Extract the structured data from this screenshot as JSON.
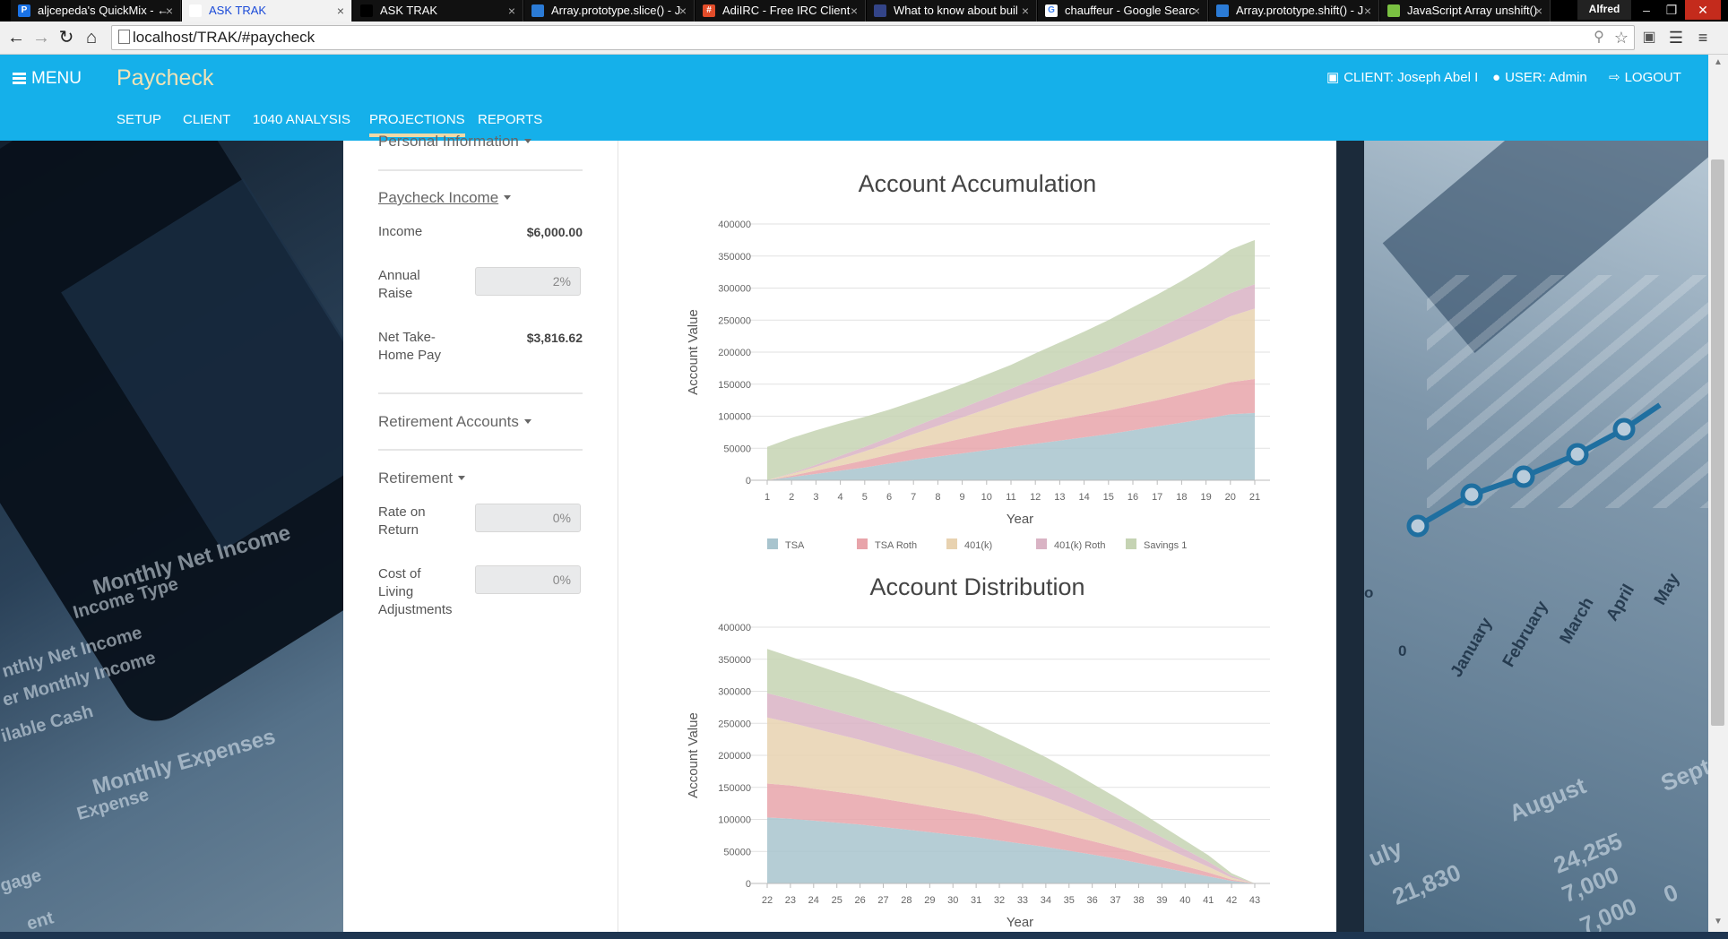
{
  "browser": {
    "tabs": [
      {
        "label": "aljcepeda's QuickMix - ←",
        "favicon": "P",
        "favcolor": "#1a73e8",
        "active": false
      },
      {
        "label": "ASK TRAK",
        "favicon": "",
        "favcolor": "#ffffff",
        "active": true
      },
      {
        "label": "ASK TRAK",
        "favicon": "",
        "favcolor": "#000000",
        "active": false
      },
      {
        "label": "Array.prototype.slice() - J",
        "favicon": "",
        "favcolor": "#2b7bd6",
        "active": false
      },
      {
        "label": "AdiIRC - Free IRC Client",
        "favicon": "#",
        "favcolor": "#e34d2a",
        "active": false
      },
      {
        "label": "What to know about buil",
        "favicon": "",
        "favcolor": "#334488",
        "active": false
      },
      {
        "label": "chauffeur - Google Searc",
        "favicon": "G",
        "favcolor": "#ffffff",
        "active": false
      },
      {
        "label": "Array.prototype.shift() - J",
        "favicon": "",
        "favcolor": "#2b7bd6",
        "active": false
      },
      {
        "label": "JavaScript Array unshift()",
        "favicon": "",
        "favcolor": "#7ac142",
        "active": false
      }
    ],
    "profile": "Alfred",
    "url": "localhost/TRAK/#paycheck"
  },
  "header": {
    "menu_label": "MENU",
    "brand": "Paycheck",
    "client_label": "CLIENT: Joseph Abel I",
    "user_label": "USER: Admin",
    "logout_label": "LOGOUT",
    "tabs": [
      "SETUP",
      "CLIENT",
      "1040 ANALYSIS",
      "PROJECTIONS",
      "REPORTS"
    ],
    "active_tab": "PROJECTIONS"
  },
  "sidebar": {
    "personal_info": "Personal Information",
    "paycheck_income": "Paycheck Income",
    "income_label": "Income",
    "income_value": "$6,000.00",
    "raise_label": "Annual Raise",
    "raise_value": "2%",
    "net_label": "Net Take-Home Pay",
    "net_value": "$3,816.62",
    "retirement_accounts": "Retirement Accounts",
    "retirement": "Retirement",
    "rate_label": "Rate on Return",
    "rate_value": "0%",
    "cola_label": "Cost of Living Adjustments",
    "cola_value": "0%"
  },
  "background": {
    "left_texts": [
      "Monthly Net Income",
      "Income Type",
      "nthly Net Income",
      "er Monthly Income",
      "ilable Cash",
      "Monthly Expenses",
      "Expense",
      "gage",
      "ent"
    ],
    "right_texts": [
      "January",
      "February",
      "March",
      "April",
      "May",
      "August",
      "Septe",
      "24,255",
      "7,000",
      "21,830",
      "7,000",
      "uly",
      "0",
      "0",
      "o"
    ]
  },
  "colors": {
    "header": "#15b0ea",
    "TSA": "#a8c4ce",
    "TSA Roth": "#e8a4aa",
    "401(k)": "#e8d2b0",
    "401(k) Roth": "#d9b3c4",
    "Savings 1": "#c5d3b3"
  },
  "chart_data": [
    {
      "type": "area",
      "stacked": true,
      "title": "Account Accumulation",
      "xlabel": "Year",
      "ylabel": "Account Value",
      "ylim": [
        0,
        400000
      ],
      "yticks": [
        0,
        50000,
        100000,
        150000,
        200000,
        250000,
        300000,
        350000,
        400000
      ],
      "x": [
        "1",
        "2",
        "3",
        "4",
        "5",
        "6",
        "7",
        "8",
        "9",
        "10",
        "11",
        "12",
        "13",
        "14",
        "15",
        "16",
        "17",
        "18",
        "19",
        "20",
        "21"
      ],
      "legend": "bottom",
      "grid": true,
      "series": [
        {
          "name": "TSA",
          "values": [
            0,
            5000,
            10000,
            15000,
            20000,
            26000,
            32000,
            37000,
            42000,
            47000,
            52000,
            57000,
            62000,
            67000,
            72000,
            78000,
            84000,
            90000,
            96000,
            103000,
            105000
          ]
        },
        {
          "name": "TSA Roth",
          "values": [
            0,
            2000,
            5000,
            8000,
            11000,
            14000,
            17000,
            20000,
            23000,
            26000,
            29000,
            31000,
            33000,
            35000,
            37000,
            39000,
            41000,
            44000,
            47000,
            50000,
            53000
          ]
        },
        {
          "name": "401(k)",
          "values": [
            0,
            3000,
            6000,
            10000,
            14000,
            18000,
            23000,
            28000,
            33000,
            38000,
            43000,
            49000,
            55000,
            61000,
            67000,
            74000,
            81000,
            88000,
            95000,
            103000,
            110000
          ]
        },
        {
          "name": "401(k) Roth",
          "values": [
            0,
            1000,
            3000,
            5000,
            7000,
            9000,
            11000,
            13000,
            15000,
            17000,
            19000,
            21000,
            23000,
            25000,
            27000,
            29000,
            31000,
            33000,
            35000,
            36000,
            38000
          ]
        },
        {
          "name": "Savings 1",
          "values": [
            52000,
            55000,
            54000,
            51000,
            47000,
            43000,
            40000,
            38000,
            37000,
            37000,
            37000,
            40000,
            42000,
            44000,
            47000,
            50000,
            53000,
            56000,
            61000,
            68000,
            69000
          ]
        }
      ]
    },
    {
      "type": "area",
      "stacked": true,
      "title": "Account Distribution",
      "xlabel": "Year",
      "ylabel": "Account Value",
      "ylim": [
        0,
        400000
      ],
      "yticks": [
        0,
        50000,
        100000,
        150000,
        200000,
        250000,
        300000,
        350000,
        400000
      ],
      "x": [
        "22",
        "23",
        "24",
        "25",
        "26",
        "27",
        "28",
        "29",
        "30",
        "31",
        "32",
        "33",
        "34",
        "35",
        "36",
        "37",
        "38",
        "39",
        "40",
        "41",
        "42",
        "43"
      ],
      "legend": "none",
      "grid": true,
      "series": [
        {
          "name": "TSA",
          "values": [
            103000,
            101000,
            98000,
            95000,
            92000,
            88000,
            84000,
            80000,
            76000,
            72000,
            67000,
            62000,
            57000,
            51000,
            45000,
            39000,
            32000,
            25000,
            18000,
            11000,
            4000,
            0
          ]
        },
        {
          "name": "TSA Roth",
          "values": [
            53000,
            52000,
            50000,
            48000,
            46000,
            44000,
            42000,
            40000,
            38000,
            36000,
            33000,
            30000,
            27000,
            24000,
            21000,
            18000,
            15000,
            12000,
            9000,
            6000,
            2000,
            0
          ]
        },
        {
          "name": "401(k)",
          "values": [
            103000,
            98000,
            94000,
            90000,
            86000,
            82000,
            78000,
            74000,
            70000,
            65000,
            60000,
            55000,
            50000,
            45000,
            39000,
            33000,
            27000,
            21000,
            15000,
            9000,
            3000,
            0
          ]
        },
        {
          "name": "401(k) Roth",
          "values": [
            38000,
            37000,
            36000,
            35000,
            34000,
            33000,
            32000,
            31000,
            30000,
            29000,
            28000,
            27000,
            25000,
            23000,
            21000,
            19000,
            17000,
            14000,
            11000,
            8000,
            3000,
            0
          ]
        },
        {
          "name": "Savings 1",
          "values": [
            69000,
            66000,
            64000,
            62000,
            60000,
            58000,
            56000,
            53000,
            50000,
            47000,
            44000,
            41000,
            38000,
            34000,
            30000,
            26000,
            22000,
            18000,
            14000,
            10000,
            4000,
            0
          ]
        }
      ]
    }
  ]
}
